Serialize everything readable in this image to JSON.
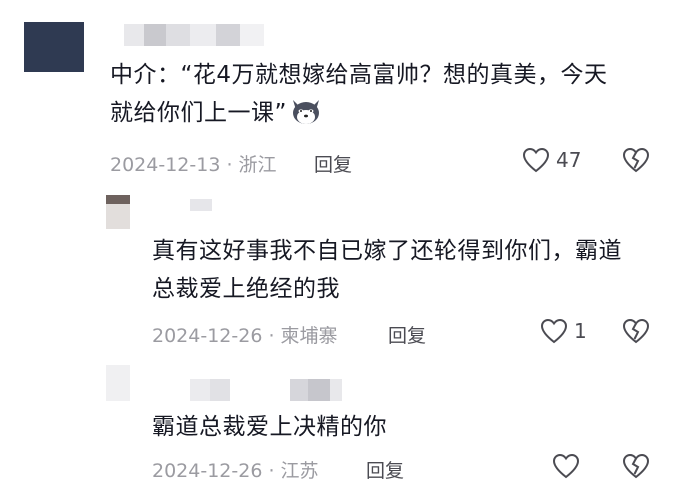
{
  "comments": [
    {
      "text": "中介：“花4万就想嫁给高富帅？想的真美，今天就给你们上一课”",
      "emoji": "husky-emoji",
      "date_location": "2024-12-13 · 浙江",
      "reply_label": "回复",
      "likes": "47"
    },
    {
      "text": "真有这好事我不自已嫁了还轮得到你们，霸道总裁爱上绝经的我",
      "date_location": "2024-12-26 · 柬埔寨",
      "reply_label": "回复",
      "likes": "1"
    },
    {
      "text": "霸道总裁爱上决精的你",
      "date_location": "2024-12-26 · 江苏",
      "reply_label": "回复",
      "likes": ""
    }
  ],
  "icons": {
    "like": "heart-outline-icon",
    "dislike": "broken-heart-icon"
  },
  "colors": {
    "text": "#161823",
    "meta": "#9b9ba1",
    "icon": "#4b4b52"
  }
}
